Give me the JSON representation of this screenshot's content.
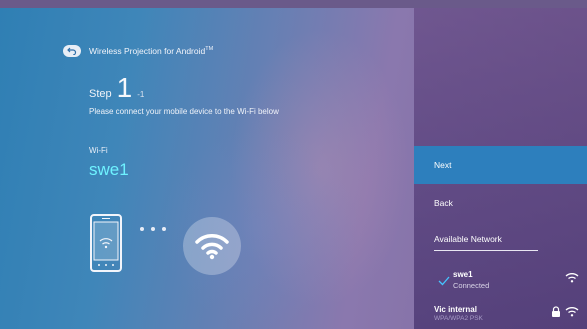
{
  "header": {
    "title": "Wireless Projection for Android",
    "title_sup": "TM"
  },
  "step": {
    "label": "Step",
    "number": "1",
    "sub": "-1",
    "instruction": "Please connect your mobile device to the Wi-Fi below"
  },
  "wifi": {
    "label": "Wi-Fi",
    "ssid": "swe1"
  },
  "menu": {
    "next_label": "Next",
    "back_label": "Back",
    "available_network_label": "Available Network"
  },
  "networks": [
    {
      "ssid": "swe1",
      "status": "Connected",
      "icon": "wifi-icon",
      "selected": true
    },
    {
      "ssid": "Vic internal",
      "security": "WPA/WPA2 PSK",
      "icon": "wifi-icon",
      "locked": true
    }
  ],
  "colors": {
    "accent": "#2d7fbd",
    "ssid_text": "#6ef2ff"
  }
}
